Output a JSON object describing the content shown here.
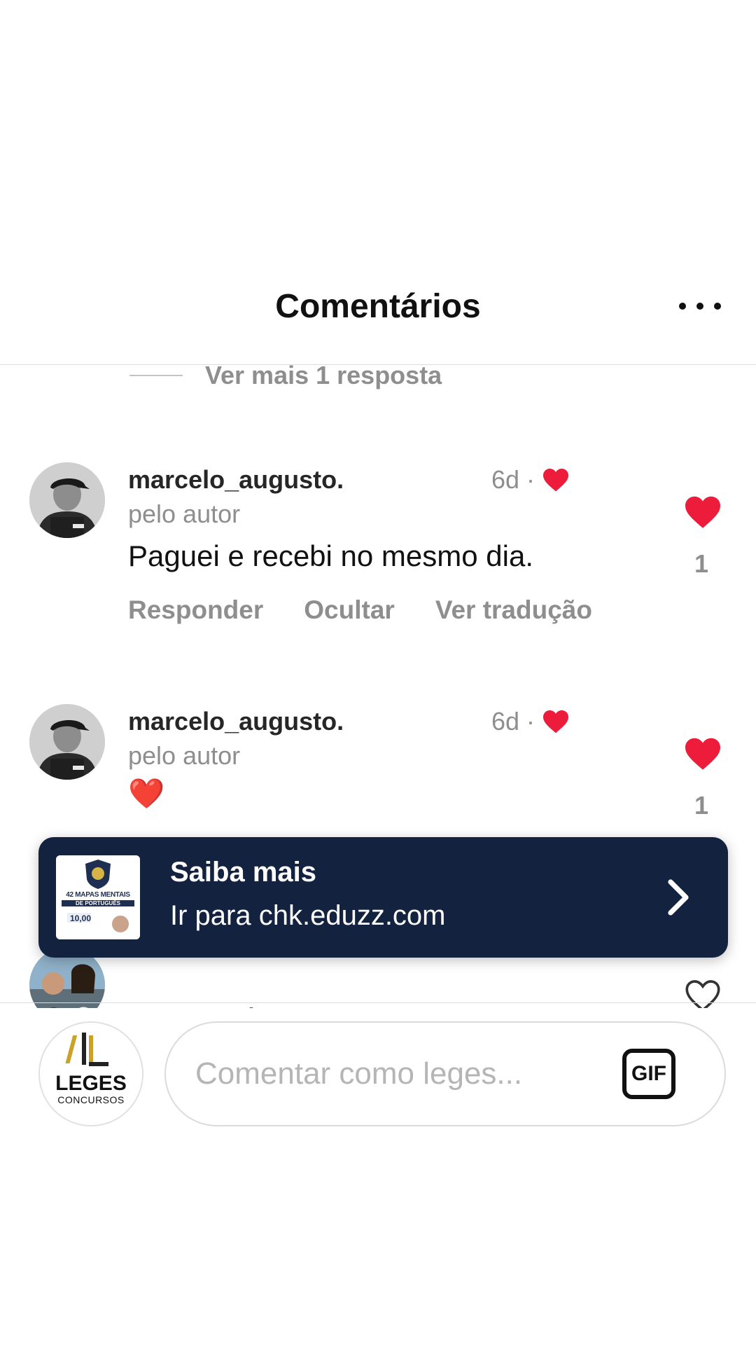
{
  "header": {
    "title": "Comentários"
  },
  "thread": {
    "more_replies": "Ver mais 1 resposta"
  },
  "comments": [
    {
      "username": "marcelo_augusto.",
      "time": "6d",
      "separator": "·",
      "by_author": "pelo autor",
      "text": "Paguei e recebi no mesmo dia.",
      "actions": {
        "reply": "Responder",
        "hide": "Ocultar",
        "translate": "Ver tradução"
      },
      "like_count": "1"
    },
    {
      "username": "marcelo_augusto.",
      "time": "6d",
      "separator": "·",
      "by_author": "pelo autor",
      "text": "❤️",
      "like_count": "1"
    },
    {
      "text": "Opa, será se serve para"
    }
  ],
  "promo": {
    "title": "Saiba mais",
    "subtitle": "Ir para chk.eduzz.com",
    "thumb": {
      "line1": "42 MAPAS MENTAIS",
      "line2": "DE PORTUGUÊS",
      "price": "10,00"
    }
  },
  "composer": {
    "avatar": {
      "line1": "LEGES",
      "line2": "CONCURSOS"
    },
    "placeholder": "Comentar como leges...",
    "gif_label": "GIF"
  },
  "colors": {
    "heart": "#ed1c3b",
    "promo_bg": "#13223f",
    "muted": "#8e8e8e"
  }
}
